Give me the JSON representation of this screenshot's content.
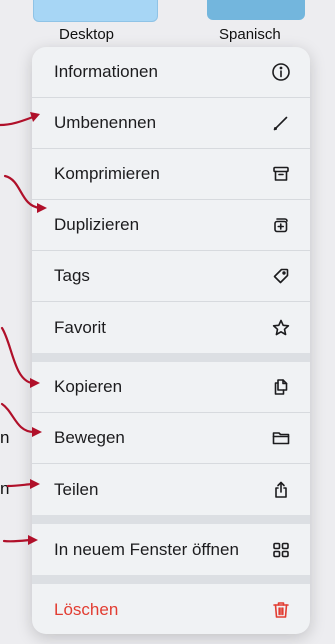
{
  "background": {
    "folders": [
      {
        "label": "Desktop"
      },
      {
        "label": "Spanisch"
      }
    ],
    "side_text": [
      "n",
      "n"
    ]
  },
  "menu": {
    "groups": [
      {
        "items": [
          {
            "label": "Informationen",
            "icon": "info-icon"
          },
          {
            "label": "Umbenennen",
            "icon": "pencil-icon"
          },
          {
            "label": "Komprimieren",
            "icon": "archive-box-icon"
          },
          {
            "label": "Duplizieren",
            "icon": "duplicate-icon"
          },
          {
            "label": "Tags",
            "icon": "tag-icon"
          },
          {
            "label": "Favorit",
            "icon": "star-icon"
          }
        ]
      },
      {
        "items": [
          {
            "label": "Kopieren",
            "icon": "copy-documents-icon"
          },
          {
            "label": "Bewegen",
            "icon": "folder-icon"
          },
          {
            "label": "Teilen",
            "icon": "share-icon"
          }
        ]
      },
      {
        "items": [
          {
            "label": "In neuem Fenster öffnen",
            "icon": "window-grid-icon"
          }
        ]
      },
      {
        "items": [
          {
            "label": "Löschen",
            "icon": "trash-icon",
            "color": "#e23d32"
          }
        ]
      }
    ]
  },
  "annotation_color": "#b0102a"
}
